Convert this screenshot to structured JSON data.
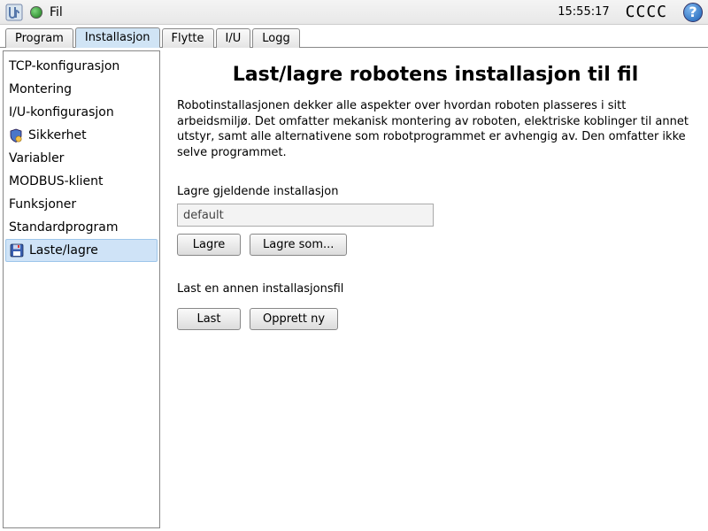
{
  "topbar": {
    "menu_file": "Fil",
    "time": "15:55:17",
    "status": "CCCC"
  },
  "tabs": [
    {
      "label": "Program",
      "active": false
    },
    {
      "label": "Installasjon",
      "active": true
    },
    {
      "label": "Flytte",
      "active": false
    },
    {
      "label": "I/U",
      "active": false
    },
    {
      "label": "Logg",
      "active": false
    }
  ],
  "sidebar": {
    "items": [
      {
        "label": "TCP-konfigurasjon"
      },
      {
        "label": "Montering"
      },
      {
        "label": "I/U-konfigurasjon"
      },
      {
        "label": "Sikkerhet",
        "icon": "shield"
      },
      {
        "label": "Variabler"
      },
      {
        "label": "MODBUS-klient"
      },
      {
        "label": "Funksjoner"
      },
      {
        "label": "Standardprogram"
      },
      {
        "label": "Laste/lagre",
        "icon": "disk",
        "selected": true
      }
    ]
  },
  "main": {
    "title": "Last/lagre robotens installasjon til fil",
    "description": "Robotinstallasjonen dekker alle aspekter over hvordan roboten plasseres i sitt arbeidsmiljø. Det omfatter mekanisk montering av roboten, elektriske koblinger til annet utstyr, samt alle alternativene som robotprogrammet er avhengig av. Den omfatter ikke selve programmet.",
    "save_section_label": "Lagre gjeldende installasjon",
    "installation_name": "default",
    "save_btn": "Lagre",
    "save_as_btn": "Lagre som...",
    "load_section_label": "Last en annen installasjonsfil",
    "load_btn": "Last",
    "create_btn": "Opprett ny"
  }
}
